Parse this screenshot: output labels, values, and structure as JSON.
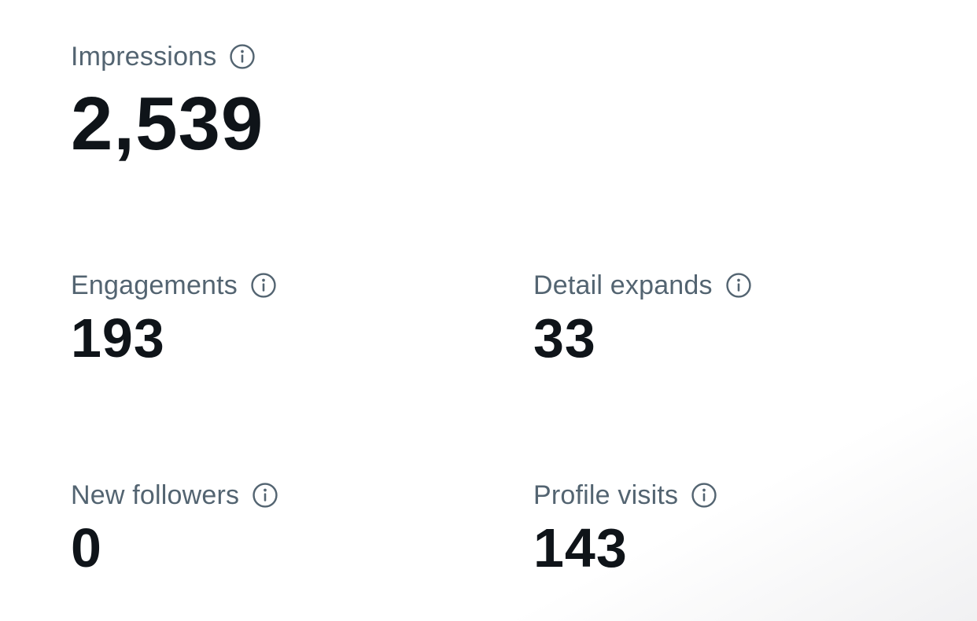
{
  "metrics": {
    "impressions": {
      "label": "Impressions",
      "value": "2,539",
      "info_icon": "info-circle-icon"
    },
    "engagements": {
      "label": "Engagements",
      "value": "193",
      "info_icon": "info-circle-icon"
    },
    "detail_expands": {
      "label": "Detail expands",
      "value": "33",
      "info_icon": "info-circle-icon"
    },
    "new_followers": {
      "label": "New followers",
      "value": "0",
      "info_icon": "info-circle-icon"
    },
    "profile_visits": {
      "label": "Profile visits",
      "value": "143",
      "info_icon": "info-circle-icon"
    }
  },
  "colors": {
    "label": "#536471",
    "value": "#0f1419",
    "background": "#ffffff"
  }
}
